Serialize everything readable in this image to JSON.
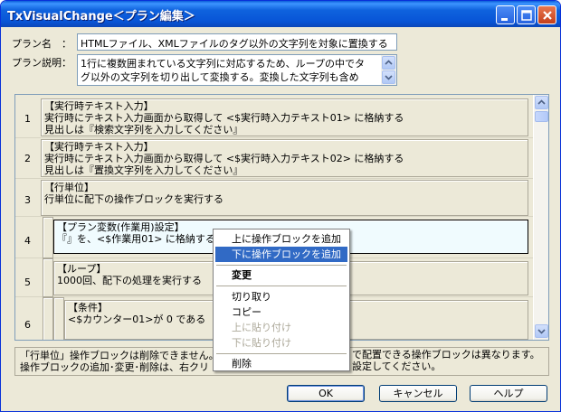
{
  "window": {
    "title": "TxVisualChange＜プラン編集＞"
  },
  "form": {
    "plan_name_label": "プラン名　：",
    "plan_name_value": "HTMLファイル、XMLファイルのタグ以外の文字列を対象に置換する",
    "plan_desc_label": "プラン説明：",
    "plan_desc_lines": [
      "1行に複数囲まれている文字列に対応するため、ループの中でタ",
      "グ以外の文字列を切り出して変換する。変換した文字列も含め"
    ]
  },
  "blocks": [
    {
      "num": "1",
      "lines": [
        "【実行時テキスト入力】",
        "実行時にテキスト入力画面から取得して <$実行時入力テキスト01> に格納する",
        "見出しは『検索文字列を入力してください』"
      ]
    },
    {
      "num": "2",
      "lines": [
        "【実行時テキスト入力】",
        "実行時にテキスト入力画面から取得して <$実行時入力テキスト02> に格納する",
        "見出しは『置換文字列を入力してください』"
      ]
    },
    {
      "num": "3",
      "lines": [
        "【行単位】",
        "行単位に配下の操作ブロックを実行する"
      ]
    },
    {
      "num": "4",
      "lines": [
        "【プラン変数(作業用)設定】",
        "『』を、<$作業用01> に格納する"
      ]
    },
    {
      "num": "5",
      "lines": [
        "【ループ】",
        "1000回、配下の処理を実行する"
      ]
    },
    {
      "num": "6",
      "lines": [
        "【条件】",
        "<$カウンター01>が 0 である"
      ]
    }
  ],
  "info": {
    "lines": [
      "「行単位」操作ブロックは削除できません。",
      "操作ブロックの追加･変更･削除は、右クリ"
    ],
    "lines_right": [
      "で配置できる操作ブロックは異なります。",
      "設定してください。"
    ]
  },
  "context_menu": {
    "items": [
      {
        "label": "上に操作ブロックを追加",
        "state": "normal"
      },
      {
        "label": "下に操作ブロックを追加",
        "state": "highlighted"
      },
      {
        "label": "変更",
        "state": "bold"
      },
      {
        "label": "切り取り",
        "state": "normal"
      },
      {
        "label": "コピー",
        "state": "normal"
      },
      {
        "label": "上に貼り付け",
        "state": "disabled"
      },
      {
        "label": "下に貼り付け",
        "state": "disabled"
      },
      {
        "label": "削除",
        "state": "normal"
      }
    ]
  },
  "buttons": {
    "ok": "OK",
    "cancel": "キャンセル",
    "help": "ヘルプ"
  },
  "colors": {
    "titlebar": "#0854d6",
    "selection": "#316ac5",
    "window_bg": "#ece9d8"
  }
}
